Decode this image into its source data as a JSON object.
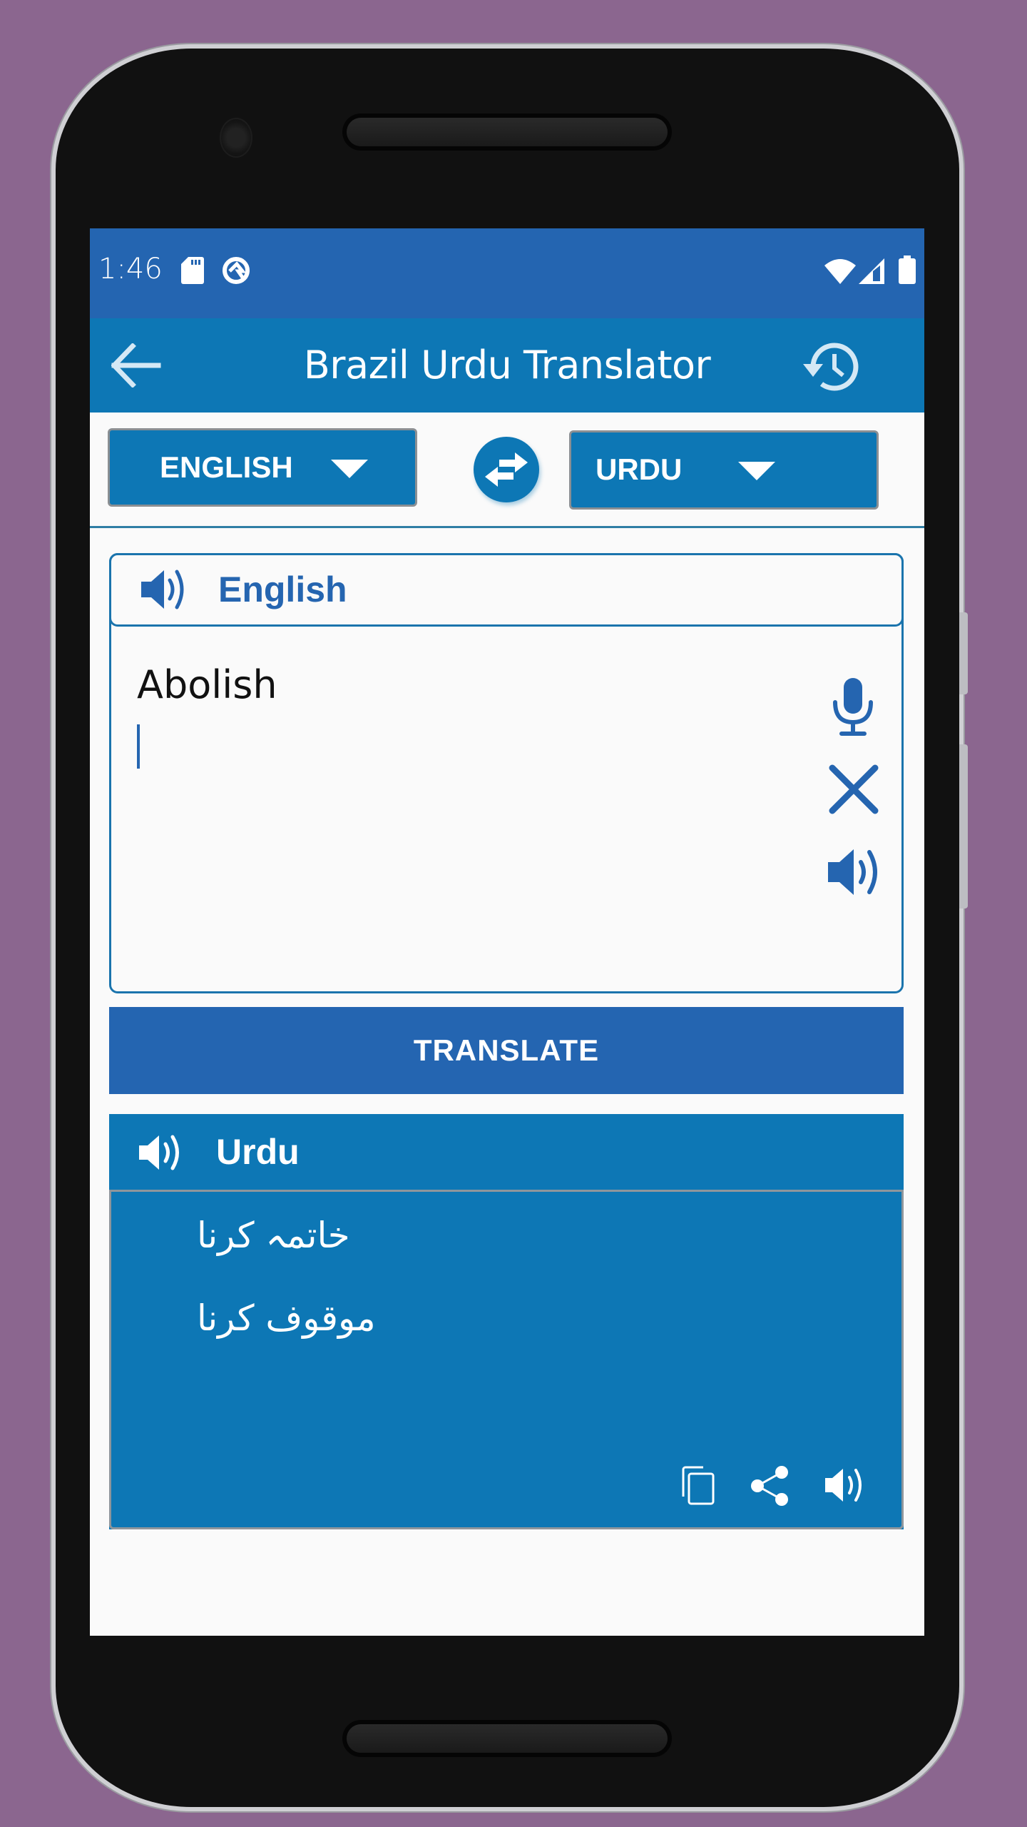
{
  "status_bar": {
    "time": "1:46",
    "left_icons": [
      "sd-card-icon",
      "data-saver-icon"
    ],
    "right_icons": [
      "wifi-icon",
      "cell-signal-icon",
      "battery-icon"
    ]
  },
  "app_bar": {
    "title": "Brazil Urdu Translator",
    "back_icon": "arrow-left-icon",
    "history_icon": "history-icon"
  },
  "language_selector": {
    "source_language": "ENGLISH",
    "target_language": "URDU",
    "swap_icon": "swap-arrows-icon"
  },
  "source_panel": {
    "language_label": "English",
    "input_value": "Abolish",
    "actions": [
      "microphone-icon",
      "clear-icon",
      "speaker-icon"
    ]
  },
  "translate_button": {
    "label": "TRANSLATE"
  },
  "result_panel": {
    "language_label": "Urdu",
    "lines": [
      "خاتمہ کرنا",
      "موقوف کرنا"
    ],
    "actions": [
      "copy-icon",
      "share-icon",
      "speaker-icon"
    ]
  },
  "colors": {
    "background": "#8b668f",
    "status_bar": "#2465b1",
    "primary": "#0d77b5",
    "accent_text": "#2565b0",
    "screen_bg": "#fafafa"
  }
}
